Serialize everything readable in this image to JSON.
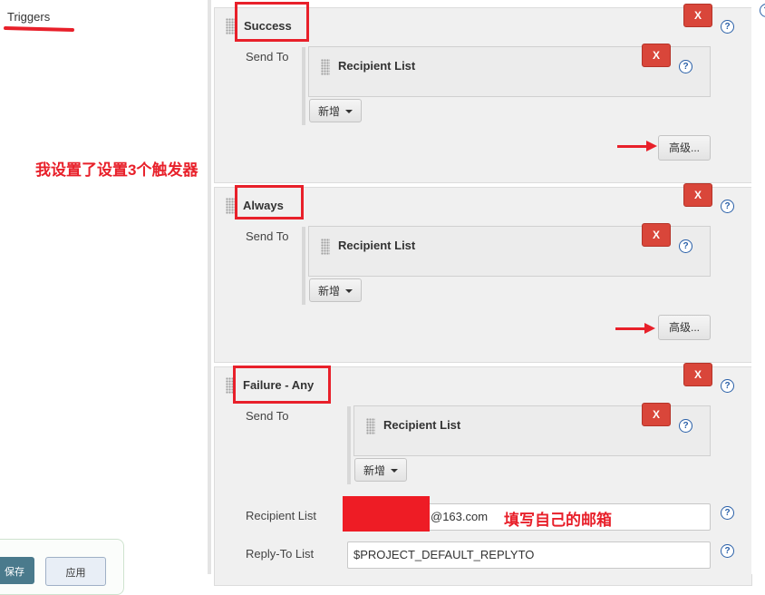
{
  "sidebar": {
    "triggers_label": "Triggers"
  },
  "annotations": {
    "left_note": "我设置了设置3个触发器",
    "email_note": "填写自己的邮箱"
  },
  "triggers": [
    {
      "name": "Success",
      "send_to_label": "Send To",
      "recipient_label": "Recipient List",
      "add_label": "新增",
      "advanced_label": "高级...",
      "delete_label": "X"
    },
    {
      "name": "Always",
      "send_to_label": "Send To",
      "recipient_label": "Recipient List",
      "add_label": "新增",
      "advanced_label": "高级...",
      "delete_label": "X"
    },
    {
      "name": "Failure - Any",
      "send_to_label": "Send To",
      "recipient_label": "Recipient List",
      "add_label": "新增",
      "delete_label": "X"
    }
  ],
  "recipient_field": {
    "label": "Recipient List",
    "value": "@163.com"
  },
  "replyto_field": {
    "label": "Reply-To List",
    "value": "$PROJECT_DEFAULT_REPLYTO"
  },
  "help_glyph": "?",
  "footer": {
    "save_label": "保存",
    "apply_label": "应用"
  },
  "colors": {
    "annotation_red": "#e8202a",
    "delete_red": "#d9463a",
    "help_blue": "#2a60a8",
    "panel_bg": "#f0f0f0"
  }
}
